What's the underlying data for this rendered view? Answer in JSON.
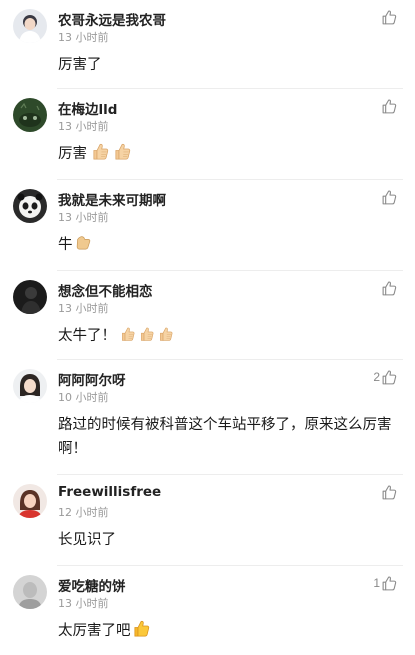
{
  "comments": [
    {
      "username": "农哥永远是我农哥",
      "time": "13 小时前",
      "text": "厉害了",
      "likes": ""
    },
    {
      "username": "在梅边lld",
      "time": "13 小时前",
      "text": "厉害",
      "likes": ""
    },
    {
      "username": "我就是未来可期啊",
      "time": "13 小时前",
      "text": "牛",
      "likes": ""
    },
    {
      "username": "想念但不能相恋",
      "time": "13 小时前",
      "text": "太牛了！",
      "likes": ""
    },
    {
      "username": "阿阿阿尔呀",
      "time": "10 小时前",
      "text": "路过的时候有被科普这个车站平移了，原来这么厉害啊！",
      "likes": "2"
    },
    {
      "username": "Freewillisfree",
      "time": "12 小时前",
      "text": "长见识了",
      "likes": ""
    },
    {
      "username": "爱吃糖的饼",
      "time": "13 小时前",
      "text": "太厉害了吧",
      "likes": "1"
    }
  ],
  "icons": {
    "like": "thumbs-up-icon",
    "emoji": "thumbs-up-emoji"
  },
  "colors": {
    "username": "#222222",
    "timestamp": "#9a9a9a",
    "like": "#8a8a8a",
    "emoji": "#f2c98a"
  }
}
